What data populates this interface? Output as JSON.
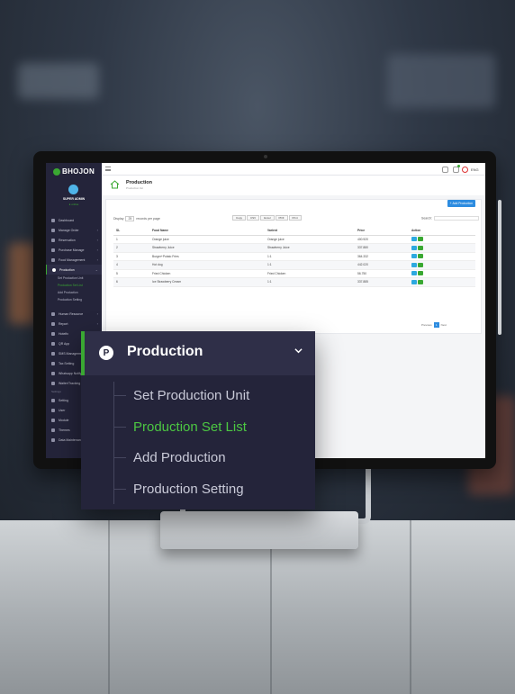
{
  "app": {
    "logo": "BHOJON",
    "user_name": "SUPER ADMIN",
    "user_status": "● online",
    "language": "ENG"
  },
  "sidebar": {
    "items": [
      {
        "label": "Dashboard",
        "icon": "dashboard-icon",
        "has_children": false
      },
      {
        "label": "Manage Order",
        "icon": "cart-icon",
        "has_children": true
      },
      {
        "label": "Reservation",
        "icon": "calendar-icon",
        "has_children": true
      },
      {
        "label": "Purchase Manage",
        "icon": "bag-icon",
        "has_children": true
      },
      {
        "label": "Food Management",
        "icon": "food-icon",
        "has_children": true
      },
      {
        "label": "Production",
        "icon": "production-icon",
        "has_children": true,
        "active": true
      }
    ],
    "production_submenu": [
      "Set Production Unit",
      "Production Set List",
      "Add Production",
      "Production Setting"
    ],
    "items_after": [
      {
        "label": "Human Resource",
        "icon": "people-icon"
      },
      {
        "label": "Report",
        "icon": "chart-icon"
      },
      {
        "label": "Hotelfx",
        "icon": "hotel-icon"
      },
      {
        "label": "QR App",
        "icon": "qr-icon"
      },
      {
        "label": "SMS Management",
        "icon": "sms-icon"
      },
      {
        "label": "Tax Setting",
        "icon": "tax-icon"
      },
      {
        "label": "Whatsapp Notify",
        "icon": "whatsapp-icon"
      },
      {
        "label": "Waiter/Tracking",
        "icon": "waiter-icon"
      }
    ],
    "section_label": "Settings",
    "items_settings": [
      {
        "label": "Setting",
        "icon": "gear-icon"
      },
      {
        "label": "User",
        "icon": "user-icon"
      },
      {
        "label": "Module",
        "icon": "module-icon"
      },
      {
        "label": "Themes",
        "icon": "themes-icon"
      },
      {
        "label": "Data Maintenance",
        "icon": "database-icon"
      }
    ]
  },
  "page": {
    "title": "Production",
    "subtitle": "Production list",
    "add_button": "Add Production",
    "display_label": "Display",
    "display_value": "25",
    "records_label": "records per page",
    "export_buttons": [
      "Copy",
      "CSV",
      "Excel",
      "PDF",
      "Print"
    ],
    "search_label": "Search:"
  },
  "table": {
    "columns": [
      "SL",
      "Food Name",
      "Varient",
      "Price",
      "Action"
    ],
    "rows": [
      {
        "sl": "1",
        "food": "Orange juice",
        "variant": "Orange juice",
        "price": "400.920"
      },
      {
        "sl": "2",
        "food": "Strawberry Juice",
        "variant": "Strawberry Juice",
        "price": "337.880"
      },
      {
        "sl": "3",
        "food": "Burger+Potato Fries",
        "variant": "1:1",
        "price": "364.332"
      },
      {
        "sl": "4",
        "food": "Hot dog",
        "variant": "1:1",
        "price": "442.020"
      },
      {
        "sl": "5",
        "food": "Fried Chicken",
        "variant": "Fried Chicken",
        "price": "56.750"
      },
      {
        "sl": "6",
        "food": "Ice Strawberry Cream",
        "variant": "1:1",
        "price": "337.885"
      }
    ]
  },
  "pager": {
    "previous": "Previous",
    "current": "1",
    "next": "Next"
  },
  "zoom_panel": {
    "header_label": "Production",
    "items": [
      {
        "label": "Set Production Unit",
        "active": false
      },
      {
        "label": "Production Set List",
        "active": true
      },
      {
        "label": "Add Production",
        "active": false
      },
      {
        "label": "Production Setting",
        "active": false
      }
    ]
  },
  "colors": {
    "accent_green": "#3aa832",
    "sidebar_bg": "#24243a",
    "primary_blue": "#2d8ce0"
  }
}
